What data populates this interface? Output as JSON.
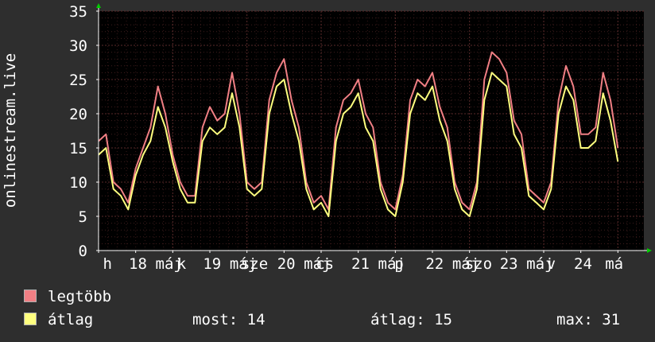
{
  "colors": {
    "background": "#2e2e2e",
    "plot_background": "#000000",
    "grid": "#5a2a2a",
    "axis": "#ffffff",
    "arrow": "#00cc00",
    "legtobb": "#f07f84",
    "atlag": "#ffff7f"
  },
  "chart_data": {
    "type": "line",
    "ylabel": "onlinestream.live",
    "ylim": [
      0,
      35
    ],
    "yticks": [
      0,
      5,
      10,
      15,
      20,
      25,
      30,
      35
    ],
    "grid": true,
    "xlim": [
      0,
      7.35
    ],
    "xticks": [
      {
        "x": 0.12,
        "label": "h"
      },
      {
        "x": 0.53,
        "label": "18"
      },
      {
        "x": 0.95,
        "label": "máj"
      },
      {
        "x": 1.12,
        "label": "k"
      },
      {
        "x": 1.53,
        "label": "19"
      },
      {
        "x": 1.95,
        "label": "máj"
      },
      {
        "x": 2.1,
        "label": "sze"
      },
      {
        "x": 2.53,
        "label": "20"
      },
      {
        "x": 2.95,
        "label": "máj"
      },
      {
        "x": 3.05,
        "label": "cs"
      },
      {
        "x": 3.53,
        "label": "21"
      },
      {
        "x": 3.95,
        "label": "máj"
      },
      {
        "x": 4.05,
        "label": "p"
      },
      {
        "x": 4.53,
        "label": "22"
      },
      {
        "x": 4.95,
        "label": "máj"
      },
      {
        "x": 5.12,
        "label": "szo"
      },
      {
        "x": 5.53,
        "label": "23"
      },
      {
        "x": 5.95,
        "label": "máj"
      },
      {
        "x": 6.1,
        "label": "v"
      },
      {
        "x": 6.53,
        "label": "24"
      },
      {
        "x": 6.95,
        "label": "má"
      }
    ],
    "series": [
      {
        "name": "legtöbb",
        "color": "#f07f84",
        "x": [
          0.0,
          0.1,
          0.2,
          0.3,
          0.4,
          0.5,
          0.6,
          0.7,
          0.8,
          0.9,
          1.0,
          1.1,
          1.2,
          1.3,
          1.4,
          1.5,
          1.6,
          1.7,
          1.8,
          1.9,
          2.0,
          2.1,
          2.2,
          2.3,
          2.4,
          2.5,
          2.6,
          2.7,
          2.8,
          2.9,
          3.0,
          3.1,
          3.2,
          3.3,
          3.4,
          3.5,
          3.6,
          3.7,
          3.8,
          3.9,
          4.0,
          4.1,
          4.2,
          4.3,
          4.4,
          4.5,
          4.6,
          4.7,
          4.8,
          4.9,
          5.0,
          5.1,
          5.2,
          5.3,
          5.4,
          5.5,
          5.6,
          5.7,
          5.8,
          5.9,
          6.0,
          6.1,
          6.2,
          6.3,
          6.4,
          6.5,
          6.6,
          6.7,
          6.8,
          6.9,
          7.0
        ],
        "values": [
          16,
          17,
          10,
          9,
          7,
          12,
          15,
          18,
          24,
          20,
          14,
          10,
          8,
          8,
          18,
          21,
          19,
          20,
          26,
          20,
          10,
          9,
          10,
          22,
          26,
          28,
          22,
          18,
          10,
          7,
          8,
          6,
          18,
          22,
          23,
          25,
          20,
          18,
          10,
          7,
          6,
          11,
          22,
          25,
          24,
          26,
          21,
          18,
          10,
          7,
          6,
          10,
          25,
          29,
          28,
          26,
          19,
          17,
          9,
          8,
          7,
          10,
          22,
          27,
          24,
          17,
          17,
          18,
          26,
          22,
          15
        ]
      },
      {
        "name": "átlag",
        "color": "#ffff7f",
        "x": [
          0.0,
          0.1,
          0.2,
          0.3,
          0.4,
          0.5,
          0.6,
          0.7,
          0.8,
          0.9,
          1.0,
          1.1,
          1.2,
          1.3,
          1.4,
          1.5,
          1.6,
          1.7,
          1.8,
          1.9,
          2.0,
          2.1,
          2.2,
          2.3,
          2.4,
          2.5,
          2.6,
          2.7,
          2.8,
          2.9,
          3.0,
          3.1,
          3.2,
          3.3,
          3.4,
          3.5,
          3.6,
          3.7,
          3.8,
          3.9,
          4.0,
          4.1,
          4.2,
          4.3,
          4.4,
          4.5,
          4.6,
          4.7,
          4.8,
          4.9,
          5.0,
          5.1,
          5.2,
          5.3,
          5.4,
          5.5,
          5.6,
          5.7,
          5.8,
          5.9,
          6.0,
          6.1,
          6.2,
          6.3,
          6.4,
          6.5,
          6.6,
          6.7,
          6.8,
          6.9,
          7.0
        ],
        "values": [
          14,
          15,
          9,
          8,
          6,
          11,
          14,
          16,
          21,
          18,
          13,
          9,
          7,
          7,
          16,
          18,
          17,
          18,
          23,
          18,
          9,
          8,
          9,
          20,
          24,
          25,
          20,
          16,
          9,
          6,
          7,
          5,
          16,
          20,
          21,
          23,
          18,
          16,
          9,
          6,
          5,
          10,
          20,
          23,
          22,
          24,
          19,
          16,
          9,
          6,
          5,
          9,
          22,
          26,
          25,
          24,
          17,
          15,
          8,
          7,
          6,
          9,
          20,
          24,
          22,
          15,
          15,
          16,
          23,
          19,
          13
        ]
      }
    ]
  },
  "legend": {
    "items": [
      {
        "label": "legtöbb",
        "color": "#f07f84"
      },
      {
        "label": "átlag",
        "color": "#ffff7f"
      }
    ]
  },
  "stats": {
    "most": "most: 14",
    "atlag": "átlag: 15",
    "max": "max: 31"
  }
}
